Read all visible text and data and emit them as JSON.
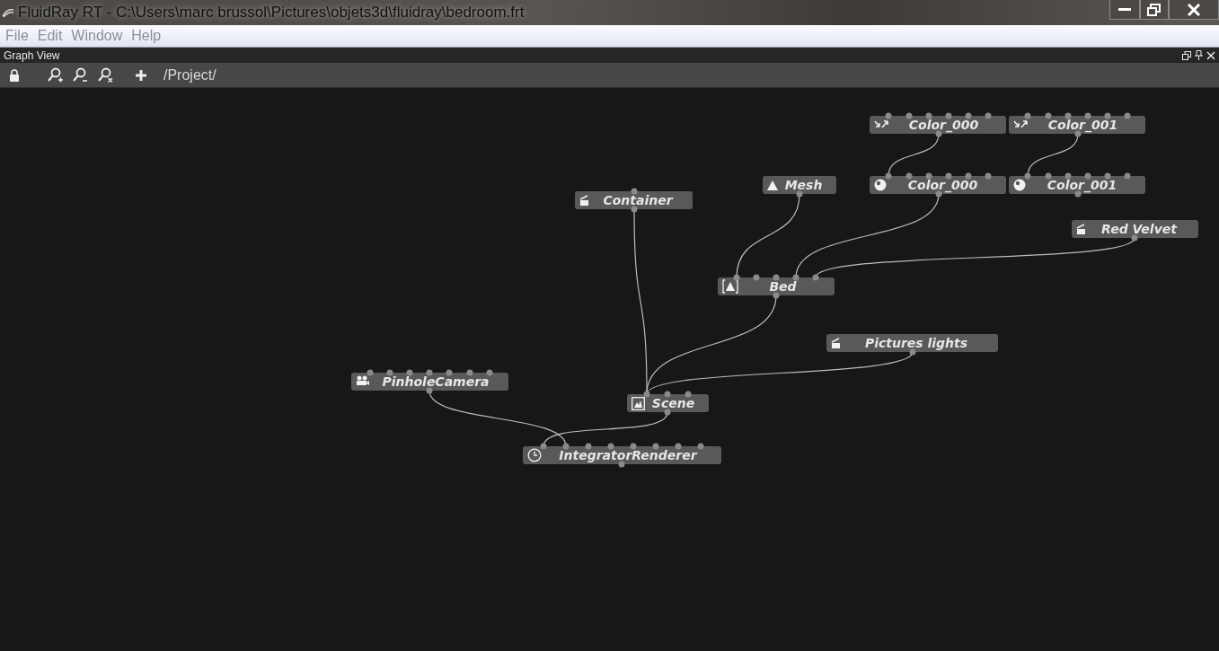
{
  "window": {
    "title": "FluidRay RT - C:\\Users\\marc brussol\\Pictures\\objets3d\\fluidray\\bedroom.frt"
  },
  "menu": [
    "File",
    "Edit",
    "Window",
    "Help"
  ],
  "panel": {
    "title": "Graph View"
  },
  "toolbar": {
    "path": "/Project/"
  },
  "nodes": [
    {
      "label": "Color_000",
      "kind": "texture"
    },
    {
      "label": "Color_001",
      "kind": "texture"
    },
    {
      "label": "Mesh",
      "kind": "mesh"
    },
    {
      "label": "Color_000",
      "kind": "color"
    },
    {
      "label": "Color_001",
      "kind": "color"
    },
    {
      "label": "Container",
      "kind": "material"
    },
    {
      "label": "Red Velvet",
      "kind": "material"
    },
    {
      "label": "Bed",
      "kind": "object"
    },
    {
      "label": "Pictures lights",
      "kind": "material"
    },
    {
      "label": "PinholeCamera",
      "kind": "camera"
    },
    {
      "label": "Scene",
      "kind": "scene"
    },
    {
      "label": "IntegratorRenderer",
      "kind": "renderer"
    }
  ]
}
